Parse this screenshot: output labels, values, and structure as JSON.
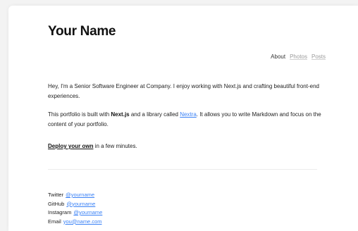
{
  "site": {
    "title": "Your Name"
  },
  "nav": {
    "items": [
      {
        "label": "About",
        "style": "active"
      },
      {
        "label": "Photos",
        "style": "muted"
      },
      {
        "label": "Posts",
        "style": "muted"
      }
    ]
  },
  "intro": {
    "p1": "Hey, I'm a Senior Software Engineer at Company. I enjoy working with Next.js and crafting beautiful front-end experiences.",
    "p2_before": "This portfolio is built with ",
    "p2_nextjs": "Next.js",
    "p2_middle": " and a library called ",
    "p2_nextra": "Nextra",
    "p2_after": ". It allows you to write Markdown and focus on the content of your portfolio.",
    "p3_link": "Deploy your own",
    "p3_after": " in a few minutes."
  },
  "socials": [
    {
      "label": "Twitter",
      "handle": "@yourname"
    },
    {
      "label": "GitHub",
      "handle": "@yourname"
    },
    {
      "label": "Instagram",
      "handle": "@yourname"
    },
    {
      "label": "Email",
      "handle": "you@name.com"
    }
  ],
  "colors": {
    "link": "#3b82f6",
    "background": "#f3f3f3",
    "card": "#ffffff"
  }
}
